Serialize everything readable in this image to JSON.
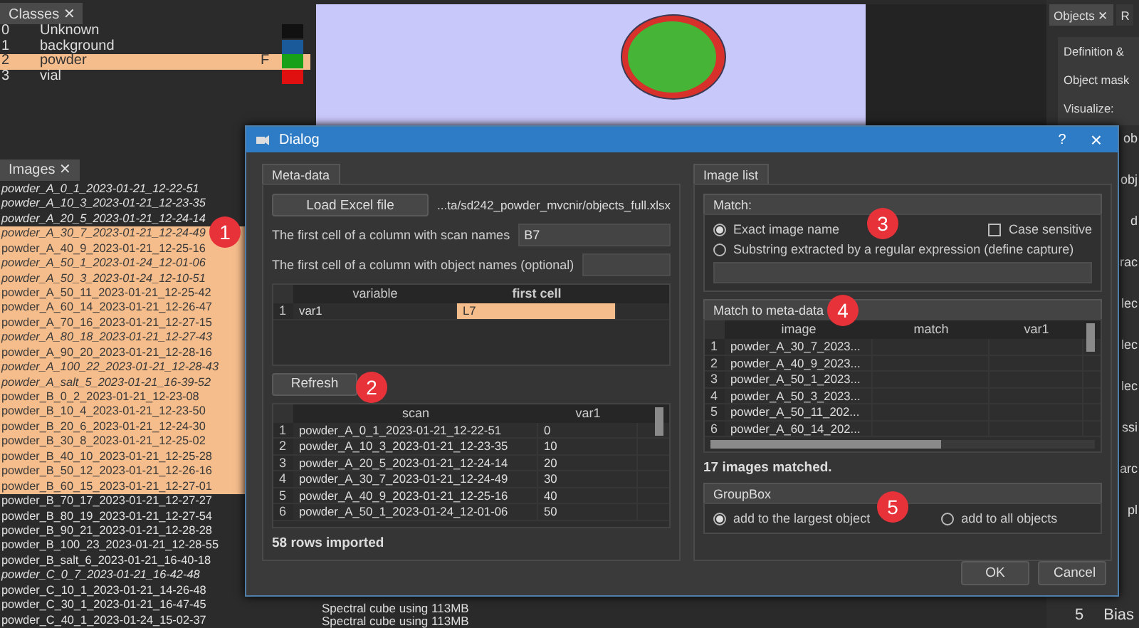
{
  "classes_panel": {
    "tab": "Classes",
    "close": "✕",
    "rows": [
      {
        "index": "0",
        "name": "Unknown",
        "color": "#111111",
        "selected": false
      },
      {
        "index": "1",
        "name": "background",
        "color": "#1a5a9a",
        "selected": false
      },
      {
        "index": "2",
        "name": "powder",
        "flag": "F",
        "color": "#18a018",
        "selected": true
      },
      {
        "index": "3",
        "name": "vial",
        "color": "#e01010",
        "selected": false
      }
    ]
  },
  "images_panel": {
    "tab": "Images",
    "close": "✕",
    "items": [
      {
        "name": "powder_A_0_1_2023-01-21_12-22-51",
        "italic": true,
        "selected": false
      },
      {
        "name": "powder_A_10_3_2023-01-21_12-23-35",
        "italic": true,
        "selected": false
      },
      {
        "name": "powder_A_20_5_2023-01-21_12-24-14",
        "italic": true,
        "selected": false
      },
      {
        "name": "powder_A_30_7_2023-01-21_12-24-49",
        "italic": true,
        "selected": true
      },
      {
        "name": "powder_A_40_9_2023-01-21_12-25-16",
        "italic": false,
        "selected": true
      },
      {
        "name": "powder_A_50_1_2023-01-24_12-01-06",
        "italic": true,
        "selected": true
      },
      {
        "name": "powder_A_50_3_2023-01-24_12-10-51",
        "italic": true,
        "selected": true
      },
      {
        "name": "powder_A_50_11_2023-01-21_12-25-42",
        "italic": false,
        "selected": true
      },
      {
        "name": "powder_A_60_14_2023-01-21_12-26-47",
        "italic": false,
        "selected": true
      },
      {
        "name": "powder_A_70_16_2023-01-21_12-27-15",
        "italic": false,
        "selected": true
      },
      {
        "name": "powder_A_80_18_2023-01-21_12-27-43",
        "italic": true,
        "selected": true
      },
      {
        "name": "powder_A_90_20_2023-01-21_12-28-16",
        "italic": false,
        "selected": true
      },
      {
        "name": "powder_A_100_22_2023-01-21_12-28-43",
        "italic": true,
        "selected": true
      },
      {
        "name": "powder_A_salt_5_2023-01-21_16-39-52",
        "italic": true,
        "selected": true
      },
      {
        "name": "powder_B_0_2_2023-01-21_12-23-08",
        "italic": false,
        "selected": true
      },
      {
        "name": "powder_B_10_4_2023-01-21_12-23-50",
        "italic": false,
        "selected": true
      },
      {
        "name": "powder_B_20_6_2023-01-21_12-24-30",
        "italic": false,
        "selected": true
      },
      {
        "name": "powder_B_30_8_2023-01-21_12-25-02",
        "italic": false,
        "selected": true
      },
      {
        "name": "powder_B_40_10_2023-01-21_12-25-28",
        "italic": false,
        "selected": true
      },
      {
        "name": "powder_B_50_12_2023-01-21_12-26-16",
        "italic": false,
        "selected": true
      },
      {
        "name": "powder_B_60_15_2023-01-21_12-27-01",
        "italic": false,
        "selected": true
      },
      {
        "name": "powder_B_70_17_2023-01-21_12-27-27",
        "italic": false,
        "selected": false
      },
      {
        "name": "powder_B_80_19_2023-01-21_12-27-54",
        "italic": false,
        "selected": false
      },
      {
        "name": "powder_B_90_21_2023-01-21_12-28-28",
        "italic": false,
        "selected": false
      },
      {
        "name": "powder_B_100_23_2023-01-21_12-28-55",
        "italic": false,
        "selected": false
      },
      {
        "name": "powder_B_salt_6_2023-01-21_16-40-18",
        "italic": false,
        "selected": false
      },
      {
        "name": "powder_C_0_7_2023-01-21_16-42-48",
        "italic": true,
        "selected": false
      },
      {
        "name": "powder_C_10_1_2023-01-21_14-26-48",
        "italic": false,
        "selected": false
      },
      {
        "name": "powder_C_30_1_2023-01-21_16-47-45",
        "italic": false,
        "selected": false
      },
      {
        "name": "powder_C_40_1_2023-01-24_15-02-37",
        "italic": false,
        "selected": false
      }
    ]
  },
  "objects_panel": {
    "tabs": [
      {
        "label": "Objects",
        "close": "✕",
        "selected": true
      },
      {
        "label": "R",
        "selected": false
      }
    ],
    "texts": [
      "Definition &",
      "Object mask",
      "Visualize:"
    ],
    "edge_fragments": [
      "ob",
      "obj",
      "d",
      "rac",
      "lec",
      "lec",
      "lec",
      "ssi",
      "arc",
      "pl"
    ]
  },
  "log": [
    "Spectral cube using 113MB",
    "Spectral cube using 113MB"
  ],
  "bottom_right": {
    "index": "5",
    "label": "Bias"
  },
  "dialog": {
    "title": "Dialog",
    "help": "?",
    "close": "×",
    "meta_data": {
      "tab": "Meta-data",
      "load_button": "Load Excel file",
      "path": "...ta/sd242_powder_mvcnir/objects_full.xlsx",
      "fields": [
        {
          "label": "The first cell of a column with scan names",
          "value": "B7"
        },
        {
          "label": "The first cell of a column with object names (optional)"
        }
      ],
      "variables": {
        "columns": [
          "variable",
          "first cell"
        ],
        "rows": [
          {
            "index": "1",
            "cells": [
              {
                "text": "var1",
                "selected": false
              },
              {
                "text": "L7",
                "selected": true
              }
            ]
          }
        ]
      },
      "refresh_button": "Refresh",
      "scans": {
        "columns": [
          "scan",
          "var1"
        ],
        "rows": [
          {
            "index": "1",
            "cells": [
              "powder_A_0_1_2023-01-21_12-22-51",
              "0"
            ]
          },
          {
            "index": "2",
            "cells": [
              "powder_A_10_3_2023-01-21_12-23-35",
              "10"
            ]
          },
          {
            "index": "3",
            "cells": [
              "powder_A_20_5_2023-01-21_12-24-14",
              "20"
            ]
          },
          {
            "index": "4",
            "cells": [
              "powder_A_30_7_2023-01-21_12-24-49",
              "30"
            ]
          },
          {
            "index": "5",
            "cells": [
              "powder_A_40_9_2023-01-21_12-25-16",
              "40"
            ]
          },
          {
            "index": "6",
            "cells": [
              "powder_A_50_1_2023-01-24_12-01-06",
              "50"
            ]
          }
        ]
      },
      "status": "58 rows imported"
    },
    "image_list": {
      "tab": "Image list",
      "match": {
        "title": "Match:",
        "options": [
          {
            "label": "Exact image name",
            "selected": true
          },
          {
            "label": "Substring extracted by a regular expression (define capture)",
            "selected": false
          }
        ],
        "case_sensitive": {
          "label": "Case sensitive",
          "checked": false
        }
      },
      "match_title": "Match to meta-data",
      "matches": {
        "columns": [
          "image",
          "match",
          "var1"
        ],
        "rows": [
          {
            "index": "1",
            "cells": [
              "powder_A_30_7_2023..."
            ]
          },
          {
            "index": "2",
            "cells": [
              "powder_A_40_9_2023..."
            ]
          },
          {
            "index": "3",
            "cells": [
              "powder_A_50_1_2023..."
            ]
          },
          {
            "index": "4",
            "cells": [
              "powder_A_50_3_2023..."
            ]
          },
          {
            "index": "5",
            "cells": [
              "powder_A_50_11_202..."
            ]
          },
          {
            "index": "6",
            "cells": [
              "powder_A_60_14_202..."
            ]
          }
        ]
      },
      "status": "17 images matched.",
      "group": {
        "title": "GroupBox",
        "options": [
          {
            "label": "add to the largest object",
            "selected": true
          },
          {
            "label": "add to all objects",
            "selected": false
          }
        ]
      }
    },
    "buttons": [
      "OK",
      "Cancel"
    ]
  },
  "annotations": [
    "1",
    "2",
    "3",
    "4",
    "5"
  ]
}
